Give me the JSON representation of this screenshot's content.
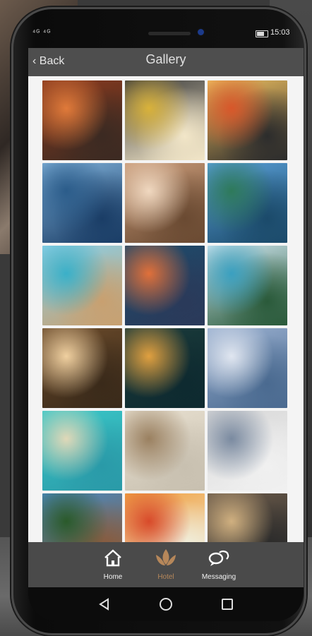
{
  "status_bar": {
    "signal_text": "⁴ᴳ ⁴ᴳ",
    "time": "15:03"
  },
  "header": {
    "back_label": "‹ Back",
    "title": "Gallery"
  },
  "gallery": {
    "tiles": [
      {
        "subject": "seafood platter",
        "colors": [
          "#8a3a1e",
          "#e07a3a",
          "#3b2a22"
        ]
      },
      {
        "subject": "shrimp pasta",
        "colors": [
          "#3a3a3a",
          "#d9b23a",
          "#f2e6c8"
        ]
      },
      {
        "subject": "tomato appetizer",
        "colors": [
          "#f0c060",
          "#d8572a",
          "#2c2c2c"
        ]
      },
      {
        "subject": "pier at sea",
        "colors": [
          "#7fb0d8",
          "#2b5c8a",
          "#1a3d66"
        ]
      },
      {
        "subject": "spa massage",
        "colors": [
          "#c89a78",
          "#f0d8c0",
          "#6a4a32"
        ]
      },
      {
        "subject": "infinity pool",
        "colors": [
          "#5aa0d8",
          "#2e7a5a",
          "#1b4a6a"
        ]
      },
      {
        "subject": "overwater villas",
        "colors": [
          "#8ad0e8",
          "#3ab0c8",
          "#c8a070"
        ]
      },
      {
        "subject": "sunset sea",
        "colors": [
          "#1e4a6a",
          "#e0703a",
          "#2a3a5a"
        ]
      },
      {
        "subject": "palm beach",
        "colors": [
          "#cfe6f0",
          "#3aa0c0",
          "#2a5a3a"
        ]
      },
      {
        "subject": "restaurant dining",
        "colors": [
          "#6a4a2a",
          "#f0d0a0",
          "#3a2a1a"
        ]
      },
      {
        "subject": "tropical night",
        "colors": [
          "#1a3a3a",
          "#e0a040",
          "#0e2a30"
        ]
      },
      {
        "subject": "beach loungers",
        "colors": [
          "#9ab0d0",
          "#e0e6f0",
          "#4a6a90"
        ]
      },
      {
        "subject": "aerial lagoon",
        "colors": [
          "#3ac8c8",
          "#e0d8b8",
          "#2a9aa8"
        ]
      },
      {
        "subject": "hotel lounge",
        "colors": [
          "#e8e0d0",
          "#9a8060",
          "#c8c0b0"
        ]
      },
      {
        "subject": "hotel bedroom",
        "colors": [
          "#d8d8d8",
          "#7a8aa0",
          "#f0f0f0"
        ]
      },
      {
        "subject": "palm resort",
        "colors": [
          "#4a8ac0",
          "#2a5a2a",
          "#8a5a3a"
        ]
      },
      {
        "subject": "pasta dishes",
        "colors": [
          "#f0a040",
          "#d84a2a",
          "#f0f0e0"
        ]
      },
      {
        "subject": "restaurant interior",
        "colors": [
          "#6a5a4a",
          "#d0b080",
          "#2a2a2a"
        ]
      }
    ]
  },
  "tabbar": {
    "home_label": "Home",
    "hotel_label": "Hotel",
    "messaging_label": "Messaging",
    "accent_color": "#b6875a"
  },
  "navbar": {
    "icons": [
      "back-triangle-icon",
      "home-circle-icon",
      "recents-square-icon"
    ]
  }
}
